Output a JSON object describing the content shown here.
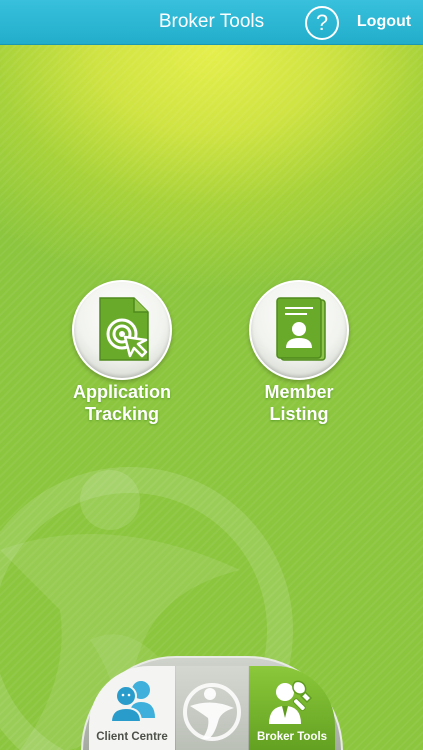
{
  "header": {
    "title": "Broker Tools",
    "help_glyph": "?",
    "logout_label": "Logout"
  },
  "menu": {
    "items": [
      {
        "label_line1": "Application",
        "label_line2": "Tracking",
        "icon": "document-target-icon"
      },
      {
        "label_line1": "Member",
        "label_line2": "Listing",
        "icon": "member-id-card-icon"
      }
    ]
  },
  "tabbar": {
    "tabs": [
      {
        "label": "Client Centre",
        "icon": "client-people-icon",
        "selected": false
      },
      {
        "label": "",
        "icon": "brand-logo-icon",
        "selected": false
      },
      {
        "label": "Broker Tools",
        "icon": "broker-wrench-icon",
        "selected": true
      }
    ]
  },
  "colors": {
    "header": "#2ab5d2",
    "background_green": "#a8d23a",
    "icon_green": "#6aaa2a",
    "broker_tab_active": "#74b22c",
    "client_icon_blue": "#3fb0dc"
  }
}
